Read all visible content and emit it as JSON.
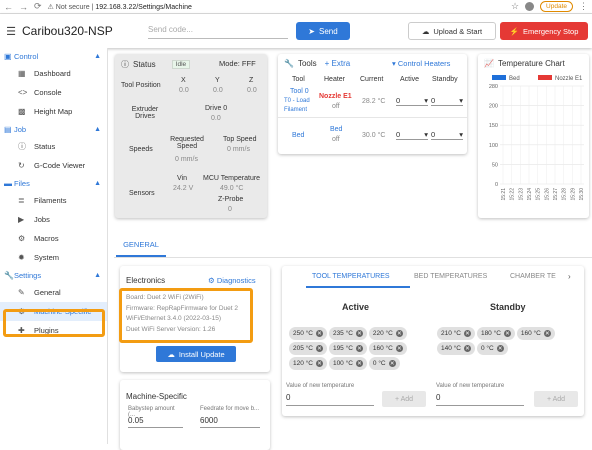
{
  "browser": {
    "security": "Not secure",
    "url": "192.168.3.22/Settings/Machine",
    "update_label": "Update"
  },
  "header": {
    "title": "Caribou320-NSP",
    "code_placeholder": "Send code...",
    "send_label": "Send",
    "upload_label": "Upload & Start",
    "estop_label": "Emergency Stop"
  },
  "sidebar": {
    "sections": [
      {
        "label": "Control",
        "items": [
          "Dashboard",
          "Console",
          "Height Map"
        ]
      },
      {
        "label": "Job",
        "items": [
          "Status",
          "G-Code Viewer"
        ]
      },
      {
        "label": "Files",
        "items": [
          "Filaments",
          "Jobs",
          "Macros",
          "System"
        ]
      },
      {
        "label": "Settings",
        "items": [
          "General",
          "Machine-Specific",
          "Plugins"
        ]
      }
    ]
  },
  "status_card": {
    "title": "Status",
    "state": "Idle",
    "mode": "Mode: FFF",
    "tool_position_label": "Tool Position",
    "axes": [
      "X",
      "Y",
      "Z"
    ],
    "axis_values": [
      "0.0",
      "0.0",
      "0.0"
    ],
    "extruder_label": "Extruder Drives",
    "drive_label": "Drive 0",
    "drive_value": "0.0",
    "speeds_label": "Speeds",
    "requested_label": "Requested Speed",
    "requested_value": "0 mm/s",
    "top_label": "Top Speed",
    "top_value": "0 mm/s",
    "sensors_label": "Sensors",
    "vin_label": "Vin",
    "vin_value": "24.2 V",
    "mcu_label": "MCU Temperature",
    "mcu_value": "49.0 °C",
    "zprobe_label": "Z-Probe",
    "zprobe_value": "0"
  },
  "tools_card": {
    "title": "Tools",
    "extra_label": "+ Extra",
    "control_heaters": "Control Heaters",
    "headers": [
      "Tool",
      "Heater",
      "Current",
      "Active",
      "Standby"
    ],
    "tool0": "Tool 0",
    "tool0_sub": "T0 - Load Filament",
    "nozzle": "Nozzle E1",
    "nozzle_state": "off",
    "nozzle_current": "28.2 °C",
    "nozzle_active": "0",
    "nozzle_standby": "0",
    "bed": "Bed",
    "bed_heater": "Bed",
    "bed_state": "off",
    "bed_current": "30.0 °C",
    "bed_active": "0",
    "bed_standby": "0"
  },
  "temp_chart": {
    "title": "Temperature Chart",
    "legend": [
      {
        "name": "Bed",
        "color": "#1e6fd9"
      },
      {
        "name": "Nozzle E1",
        "color": "#e53935"
      }
    ],
    "y_ticks": [
      "280",
      "200",
      "150",
      "100",
      "50",
      "0"
    ],
    "x_ticks": [
      "15:21",
      "15:22",
      "15:23",
      "15:24",
      "15:25",
      "15:26",
      "15:27",
      "15:28",
      "15:29",
      "15:30"
    ]
  },
  "settings": {
    "tab": "GENERAL",
    "electronics_title": "Electronics",
    "diagnostics_label": "Diagnostics",
    "lines": [
      "Board: Duet 2 WiFi (2WiFi)",
      "Firmware: RepRapFirmware for Duet 2",
      "WiFi/Ethernet 3.4.0 (2022-03-15)",
      "Duet WiFi Server Version: 1.26"
    ],
    "install_label": "Install Update",
    "machine_title": "Machine-Specific",
    "babystep_label": "Babystep amount (...",
    "babystep_value": "0.05",
    "feedrate_label": "Feedrate for move b...",
    "feedrate_value": "6000"
  },
  "temps_panel": {
    "tabs": [
      "TOOL TEMPERATURES",
      "BED TEMPERATURES",
      "CHAMBER TE"
    ],
    "active_title": "Active",
    "standby_title": "Standby",
    "active_chips": [
      "250 °C",
      "235 °C",
      "220 °C",
      "205 °C",
      "195 °C",
      "160 °C",
      "120 °C",
      "100 °C",
      "0 °C"
    ],
    "standby_chips": [
      "210 °C",
      "180 °C",
      "160 °C",
      "140 °C",
      "0 °C"
    ],
    "new_value_label": "Value of new temperature",
    "active_input": "0",
    "standby_input": "0",
    "add_label": "+ Add"
  },
  "colors": {
    "accent": "#2f78d8",
    "danger": "#e53935",
    "highlight": "#f39c12"
  }
}
